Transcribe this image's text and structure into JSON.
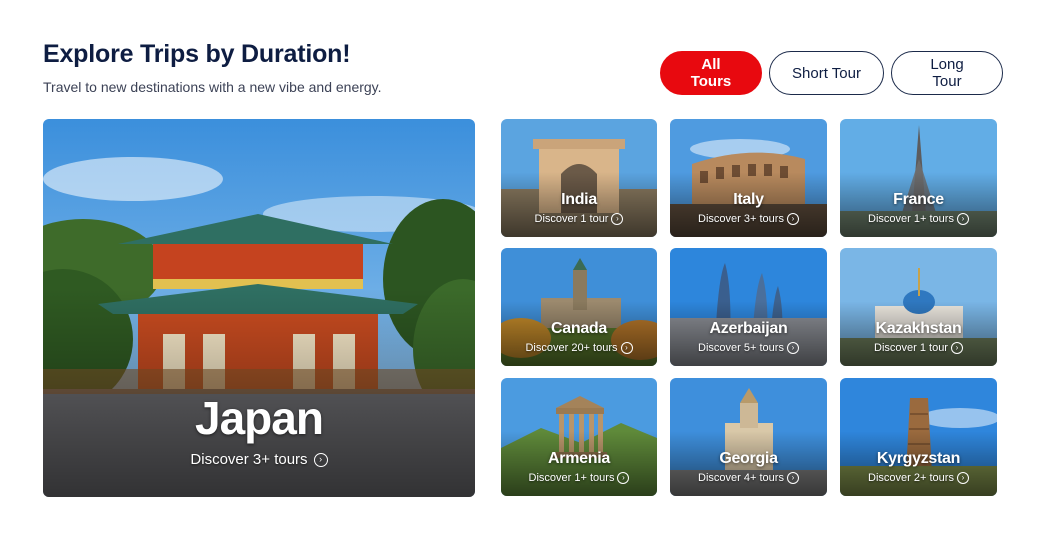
{
  "header": {
    "title": "Explore Trips by Duration!",
    "subtitle": "Travel to new destinations with a new vibe and energy."
  },
  "filters": [
    {
      "label": "All Tours",
      "active": true
    },
    {
      "label": "Short Tour",
      "active": false
    },
    {
      "label": "Long Tour",
      "active": false
    }
  ],
  "featured": {
    "name": "Japan",
    "discover": "Discover 3+ tours"
  },
  "destinations": [
    {
      "name": "India",
      "discover": "Discover 1 tour"
    },
    {
      "name": "Italy",
      "discover": "Discover 3+ tours"
    },
    {
      "name": "France",
      "discover": "Discover 1+ tours"
    },
    {
      "name": "Canada",
      "discover": "Discover 20+ tours"
    },
    {
      "name": "Azerbaijan",
      "discover": "Discover 5+ tours"
    },
    {
      "name": "Kazakhstan",
      "discover": "Discover 1 tour"
    },
    {
      "name": "Armenia",
      "discover": "Discover 1+ tours"
    },
    {
      "name": "Georgia",
      "discover": "Discover 4+ tours"
    },
    {
      "name": "Kyrgyzstan",
      "discover": "Discover 2+ tours"
    }
  ],
  "colors": {
    "accent": "#e8090f",
    "text": "#0e1d42",
    "outline": "#1b2a4a"
  }
}
